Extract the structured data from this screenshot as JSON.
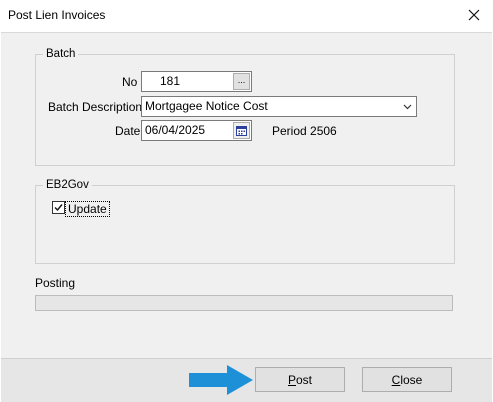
{
  "window": {
    "title": "Post Lien Invoices",
    "close_icon": "close-icon"
  },
  "batch": {
    "legend": "Batch",
    "no_label": "No",
    "no_value": "181",
    "lookup_glyph": "...",
    "desc_label": "Batch Description",
    "desc_value": "Mortgagee Notice Cost",
    "date_label": "Date",
    "date_value": "06/04/2025",
    "period_text": "Period 2506"
  },
  "eb2gov": {
    "legend": "EB2Gov",
    "update_label": "Update",
    "update_checked": true
  },
  "posting": {
    "label": "Posting",
    "progress": 0
  },
  "buttons": {
    "post_accel": "P",
    "post_rest": "ost",
    "close_accel": "C",
    "close_rest": "lose"
  },
  "annotation": {
    "arrow_color": "#1e90d8"
  }
}
